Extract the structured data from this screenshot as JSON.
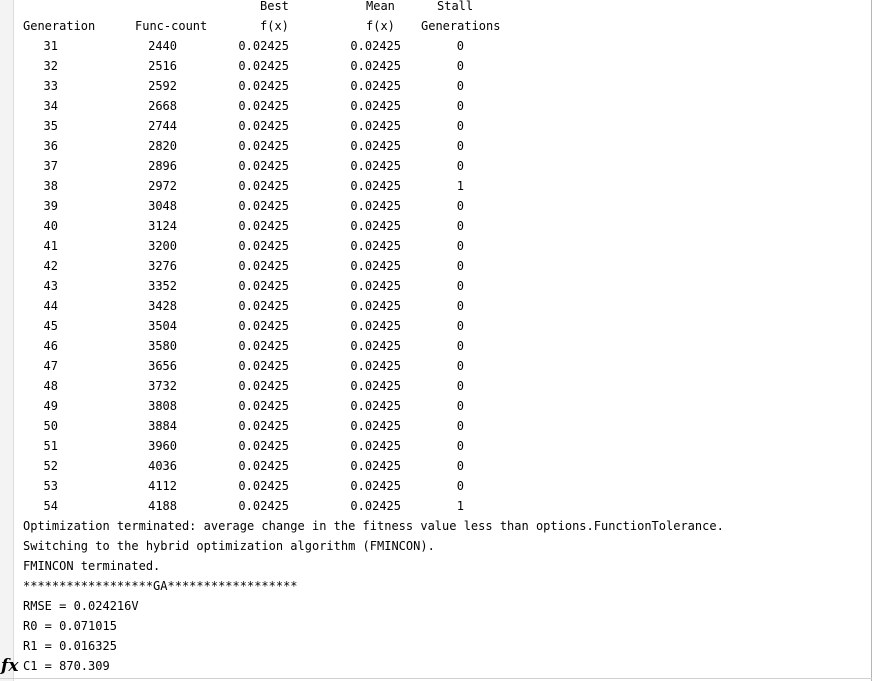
{
  "header": {
    "row1": {
      "best": "Best",
      "mean": "Mean",
      "stall": "Stall"
    },
    "row2": {
      "generation": "Generation",
      "func_count": "Func-count",
      "best_fx": "f(x)",
      "mean_fx": "f(x)",
      "stall_gen": "Generations"
    }
  },
  "rows": [
    [
      "31",
      "2440",
      "0.02425",
      "0.02425",
      "0"
    ],
    [
      "32",
      "2516",
      "0.02425",
      "0.02425",
      "0"
    ],
    [
      "33",
      "2592",
      "0.02425",
      "0.02425",
      "0"
    ],
    [
      "34",
      "2668",
      "0.02425",
      "0.02425",
      "0"
    ],
    [
      "35",
      "2744",
      "0.02425",
      "0.02425",
      "0"
    ],
    [
      "36",
      "2820",
      "0.02425",
      "0.02425",
      "0"
    ],
    [
      "37",
      "2896",
      "0.02425",
      "0.02425",
      "0"
    ],
    [
      "38",
      "2972",
      "0.02425",
      "0.02425",
      "1"
    ],
    [
      "39",
      "3048",
      "0.02425",
      "0.02425",
      "0"
    ],
    [
      "40",
      "3124",
      "0.02425",
      "0.02425",
      "0"
    ],
    [
      "41",
      "3200",
      "0.02425",
      "0.02425",
      "0"
    ],
    [
      "42",
      "3276",
      "0.02425",
      "0.02425",
      "0"
    ],
    [
      "43",
      "3352",
      "0.02425",
      "0.02425",
      "0"
    ],
    [
      "44",
      "3428",
      "0.02425",
      "0.02425",
      "0"
    ],
    [
      "45",
      "3504",
      "0.02425",
      "0.02425",
      "0"
    ],
    [
      "46",
      "3580",
      "0.02425",
      "0.02425",
      "0"
    ],
    [
      "47",
      "3656",
      "0.02425",
      "0.02425",
      "0"
    ],
    [
      "48",
      "3732",
      "0.02425",
      "0.02425",
      "0"
    ],
    [
      "49",
      "3808",
      "0.02425",
      "0.02425",
      "0"
    ],
    [
      "50",
      "3884",
      "0.02425",
      "0.02425",
      "0"
    ],
    [
      "51",
      "3960",
      "0.02425",
      "0.02425",
      "0"
    ],
    [
      "52",
      "4036",
      "0.02425",
      "0.02425",
      "0"
    ],
    [
      "53",
      "4112",
      "0.02425",
      "0.02425",
      "0"
    ],
    [
      "54",
      "4188",
      "0.02425",
      "0.02425",
      "1"
    ]
  ],
  "messages": [
    "Optimization terminated: average change in the fitness value less than options.FunctionTolerance.",
    "Switching to the hybrid optimization algorithm (FMINCON).",
    "FMINCON terminated.",
    "******************GA******************",
    "RMSE = 0.024216V",
    "R0 = 0.071015",
    "R1 = 0.016325",
    "C1 = 870.309"
  ],
  "prompt": {
    "icon": "fx-icon",
    "glyph": "fx"
  }
}
